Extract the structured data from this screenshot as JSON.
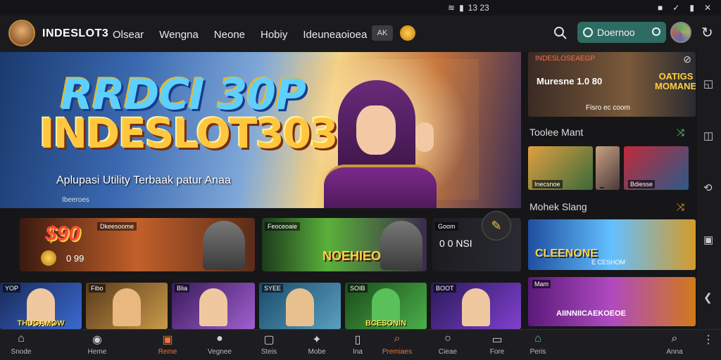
{
  "status_bar": {
    "time": "13 23",
    "icons": [
      "wifi-icon",
      "signal-icon"
    ],
    "right_icons": [
      "square-icon",
      "check-icon",
      "battery-icon",
      "close-icon"
    ]
  },
  "header": {
    "brand": "INDESLOT3",
    "nav": [
      "Olsear",
      "Wengna",
      "Neone",
      "Hobiy",
      "Ideuneaoioea"
    ],
    "chip_label": "AK",
    "download_label": "Doernoo",
    "refresh_glyph": "↻"
  },
  "hero": {
    "title_line1": "RRDCI 30P",
    "title_line2": "INDESLOT303",
    "subtitle": "Aplupasi Utility Terbaak patur Anaa",
    "tiny": "Ibeeroes"
  },
  "promo_row": [
    {
      "tag": "Dkeesoome",
      "price": "$90",
      "mini": "0 99",
      "label": ""
    },
    {
      "tag": "Feoceoaie",
      "label": "NOEHIEOS"
    },
    {
      "tag": "Goom",
      "value": "0 0 NSI"
    }
  ],
  "fab_glyph": "✎",
  "game_tiles": [
    {
      "tag": "YOP",
      "title": "THUGAMOW",
      "color1": "#1a2a5a",
      "color2": "#3a6ad0"
    },
    {
      "tag": "Fibo",
      "title": "",
      "color1": "#5a3a1a",
      "color2": "#c89a4a"
    },
    {
      "tag": "Blia",
      "title": "",
      "color1": "#3a1a5a",
      "color2": "#a060d0"
    },
    {
      "tag": "SYEE",
      "title": "",
      "color1": "#1a4a6a",
      "color2": "#5aa0c0"
    },
    {
      "tag": "SOIB",
      "title": "BCESONIN",
      "color1": "#1a4a1a",
      "color2": "#4ab04a"
    },
    {
      "tag": "BOOT",
      "title": "",
      "color1": "#2a1a5a",
      "color2": "#8040d0"
    }
  ],
  "side": {
    "card1": {
      "top": "INDESLOSEAEGP",
      "left": "Muresne 1.0 80",
      "bottom": "Fisro ec coom",
      "right": "OATIGS MOMANES"
    },
    "section1": "Toolee Mant",
    "thumbs": [
      {
        "label": "Inecsnoe"
      },
      {
        "label": ""
      },
      {
        "label": "Bdiesse"
      }
    ],
    "section2": "Mohek Slang",
    "card3": {
      "title": "CLEENONE",
      "sub": "E CESHOM"
    },
    "card4": {
      "tag": "Mam",
      "title": "AIINNIICAEKOEOE"
    }
  },
  "rail_icons": [
    "chat-icon",
    "camera-icon",
    "rotate-icon",
    "frame-icon",
    "back-icon"
  ],
  "bottom_nav": [
    {
      "label": "Snode",
      "icon": "home-icon",
      "glyph": "⌂"
    },
    {
      "label": "Heme",
      "icon": "globe-icon",
      "glyph": "◉"
    },
    {
      "label": "Reme",
      "icon": "document-icon",
      "glyph": "▣",
      "orange": true
    },
    {
      "label": "Vegnee",
      "icon": "user-icon",
      "glyph": "●"
    },
    {
      "label": "Steis",
      "icon": "box-icon",
      "glyph": "▢"
    },
    {
      "label": "Mobe",
      "icon": "gift-icon",
      "glyph": "✦"
    },
    {
      "label": "Ina",
      "icon": "cup-icon",
      "glyph": "▯"
    },
    {
      "label": "Premiaes",
      "icon": "search-icon",
      "glyph": "⌕",
      "orange": true
    },
    {
      "label": "Cieae",
      "icon": "magnify-icon",
      "glyph": "○"
    },
    {
      "label": "Fore",
      "icon": "tv-icon",
      "glyph": "▭"
    },
    {
      "label": "Peris",
      "icon": "home-icon",
      "glyph": "⌂",
      "active": true
    },
    {
      "label": "Anna",
      "icon": "search-icon",
      "glyph": "⌕"
    },
    {
      "label": "",
      "icon": "more-icon",
      "glyph": "⋮"
    }
  ],
  "colors": {
    "accent": "#2e6b62",
    "active_nav": "#5ac08a",
    "background": "#161618"
  }
}
